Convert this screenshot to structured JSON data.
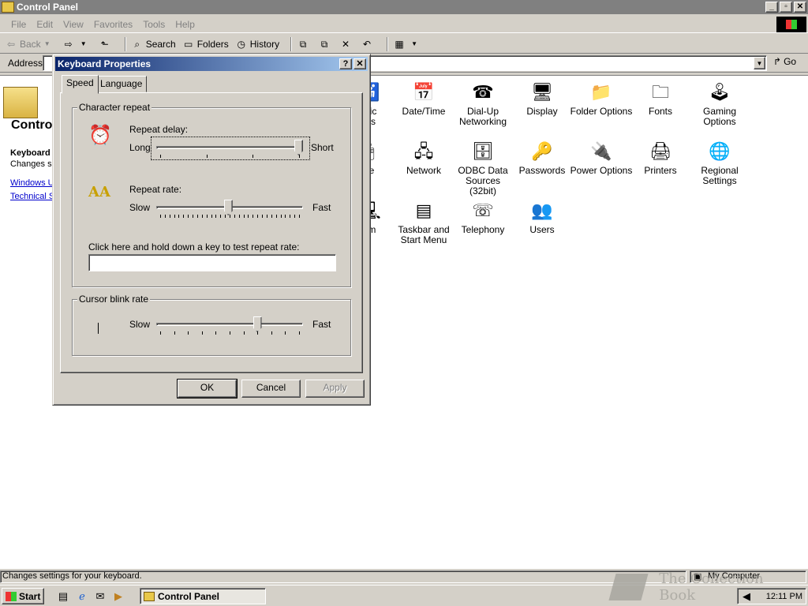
{
  "window": {
    "title": "Control Panel"
  },
  "menubar": {
    "items": [
      "File",
      "Edit",
      "View",
      "Favorites",
      "Tools",
      "Help"
    ]
  },
  "toolbar": {
    "back": "Back",
    "search": "Search",
    "folders": "Folders",
    "history": "History"
  },
  "addressbar": {
    "label": "Address",
    "value": "",
    "go": "Go"
  },
  "leftpanel": {
    "heading": "Contro",
    "selected_title": "Keyboard",
    "selected_desc": "Changes se",
    "links": [
      "Windows U",
      "Technical S"
    ]
  },
  "icons": [
    {
      "label": "atic\ntes",
      "icon": "accessibility-icon"
    },
    {
      "label": "Date/Time",
      "icon": "calendar-clock-icon"
    },
    {
      "label": "Dial-Up\nNetworking",
      "icon": "dialup-icon"
    },
    {
      "label": "Display",
      "icon": "monitor-icon"
    },
    {
      "label": "Folder Options",
      "icon": "folder-options-icon"
    },
    {
      "label": "Fonts",
      "icon": "fonts-folder-icon"
    },
    {
      "label": "Gaming\nOptions",
      "icon": "joystick-icon"
    },
    {
      "label": "se",
      "icon": "mouse-icon"
    },
    {
      "label": "Network",
      "icon": "network-icon"
    },
    {
      "label": "ODBC Data\nSources (32bit)",
      "icon": "odbc-icon"
    },
    {
      "label": "Passwords",
      "icon": "keys-icon"
    },
    {
      "label": "Power Options",
      "icon": "power-icon"
    },
    {
      "label": "Printers",
      "icon": "printer-folder-icon"
    },
    {
      "label": "Regional\nSettings",
      "icon": "globe-icon"
    },
    {
      "label": "em",
      "icon": "system-icon"
    },
    {
      "label": "Taskbar and\nStart Menu",
      "icon": "taskbar-icon"
    },
    {
      "label": "Telephony",
      "icon": "telephony-icon"
    },
    {
      "label": "Users",
      "icon": "users-icon"
    }
  ],
  "statusbar": {
    "text": "Changes settings for your keyboard.",
    "zone": "My Computer"
  },
  "taskbar": {
    "start": "Start",
    "task": "Control Panel",
    "clock": "12:11 PM"
  },
  "watermark": "The Collection Book",
  "dialog": {
    "title": "Keyboard Properties",
    "tabs": [
      "Speed",
      "Language"
    ],
    "char_repeat": {
      "legend": "Character repeat",
      "delay_label": "Repeat delay:",
      "delay_left": "Long",
      "delay_right": "Short",
      "delay_value": 1.0,
      "rate_label": "Repeat rate:",
      "rate_left": "Slow",
      "rate_right": "Fast",
      "rate_value": 0.49,
      "test_label": "Click here and hold down a key to test repeat rate:",
      "test_value": ""
    },
    "cursor_blink": {
      "legend": "Cursor blink rate",
      "left": "Slow",
      "right": "Fast",
      "value": 0.7
    },
    "buttons": {
      "ok": "OK",
      "cancel": "Cancel",
      "apply": "Apply"
    }
  }
}
